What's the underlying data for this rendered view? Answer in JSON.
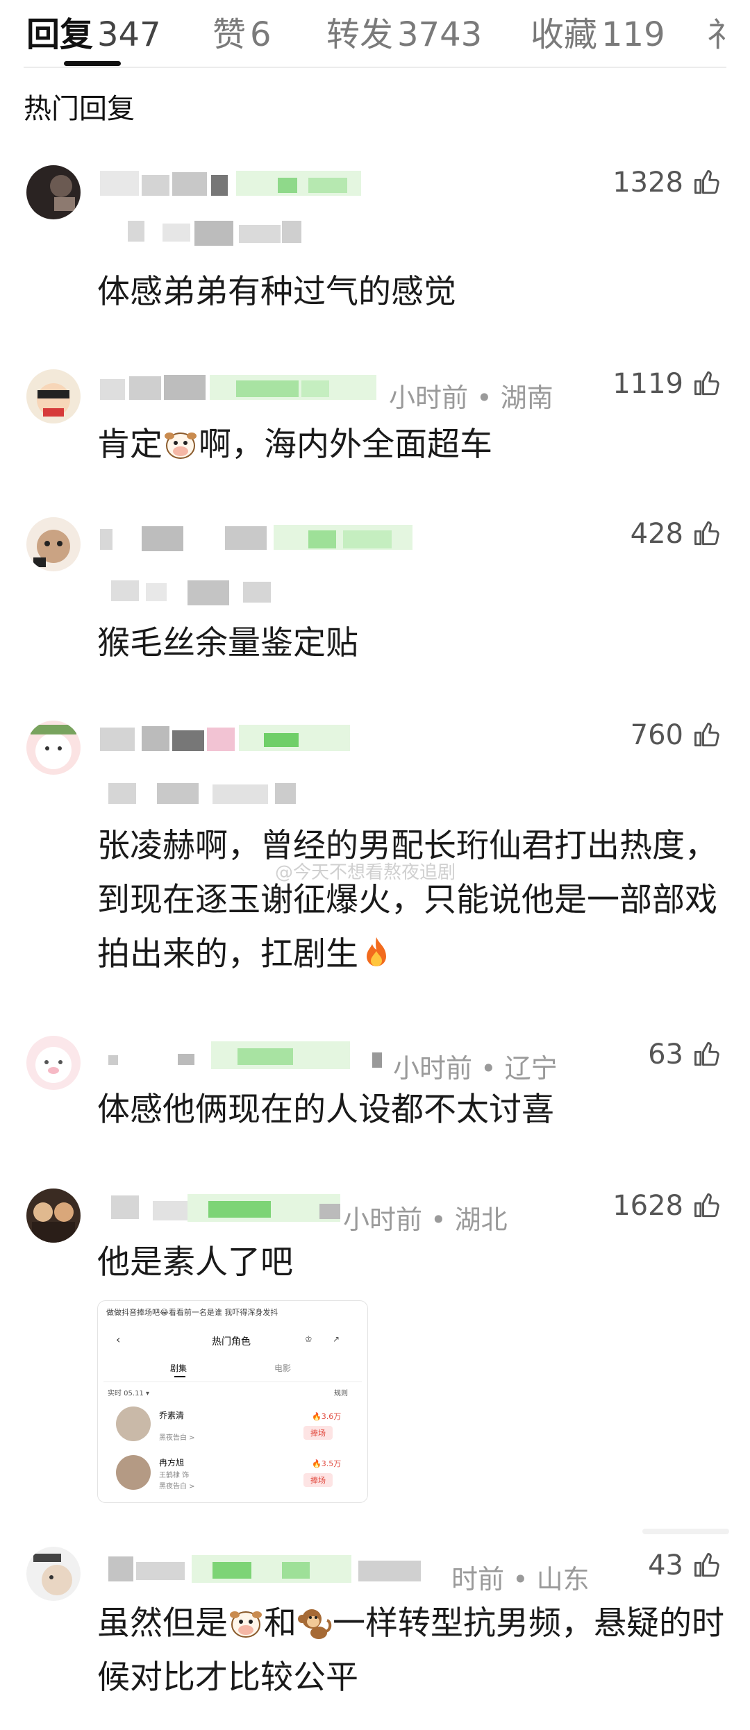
{
  "tabs": [
    {
      "label": "回复",
      "count": "347",
      "active": true
    },
    {
      "label": "赞",
      "count": "6"
    },
    {
      "label": "转发",
      "count": "3743"
    },
    {
      "label": "收藏",
      "count": "119"
    },
    {
      "label": "礻"
    }
  ],
  "section_title": "热门回复",
  "watermark": "@今天不想看熬夜追剧",
  "comments": [
    {
      "likes": "1328",
      "meta": "",
      "body": "体感弟弟有种过气的感觉"
    },
    {
      "likes": "1119",
      "meta": "小时前 • 湖南",
      "body_a": "肯定",
      "emoji_a": "cow-emoji",
      "body_b": "啊，海内外全面超车"
    },
    {
      "likes": "428",
      "meta": "",
      "body": "猴毛丝余量鉴定贴"
    },
    {
      "likes": "760",
      "meta": "",
      "body": "张凌赫啊，曾经的男配长珩仙君打出热度，到现在逐玉谢征爆火，只能说他是一部部戏拍出来的，扛剧生",
      "emoji": "fire-emoji"
    },
    {
      "likes": "63",
      "meta": "小时前 • 辽宁",
      "body": "体感他俩现在的人设都不太讨喜"
    },
    {
      "likes": "1628",
      "meta": "小时前 • 湖北",
      "body": "他是素人了吧"
    },
    {
      "likes": "43",
      "meta": "时前 • 山东",
      "body_a": "虽然但是",
      "emoji_a": "cow-emoji",
      "body_b": "和",
      "emoji_b": "monkey-emoji",
      "body_c": "一样转型抗男频，悬疑的时候对比才比较公平"
    }
  ],
  "embedded_screenshot": {
    "header": "做做抖音捧场吧😂看看前一名是谁 我吓得浑身发抖",
    "title": "热门角色",
    "tab_left": "剧集",
    "tab_right": "电影",
    "realtime": "实时 05.11 ▾",
    "rule": "规则",
    "rows": [
      {
        "name": "乔素清",
        "sub": "黑夜告白 >",
        "score": "🔥3.6万",
        "button": "捧场"
      },
      {
        "name": "冉方旭",
        "sub": "王鹤棣 饰",
        "sub2": "黑夜告白 >",
        "score": "🔥3.5万",
        "button": "捧场"
      }
    ]
  }
}
